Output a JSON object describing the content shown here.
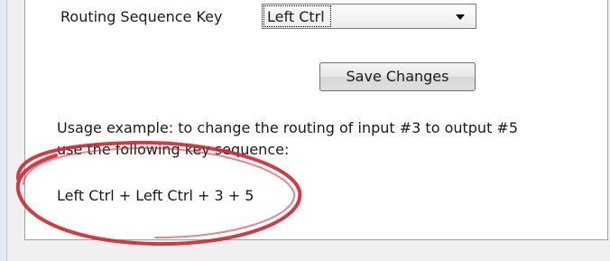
{
  "settings": {
    "routing_sequence_label": "Routing Sequence Key",
    "routing_sequence_value": "Left Ctrl",
    "save_label": "Save Changes"
  },
  "usage": {
    "line1": "Usage example: to change the routing of input #3 to output #5",
    "line2": "use the following key sequence:",
    "key_sequence": "Left Ctrl + Left Ctrl + 3 + 5"
  },
  "annotation": {
    "color": "#d0242e",
    "icon": "hand-drawn-ellipse"
  }
}
